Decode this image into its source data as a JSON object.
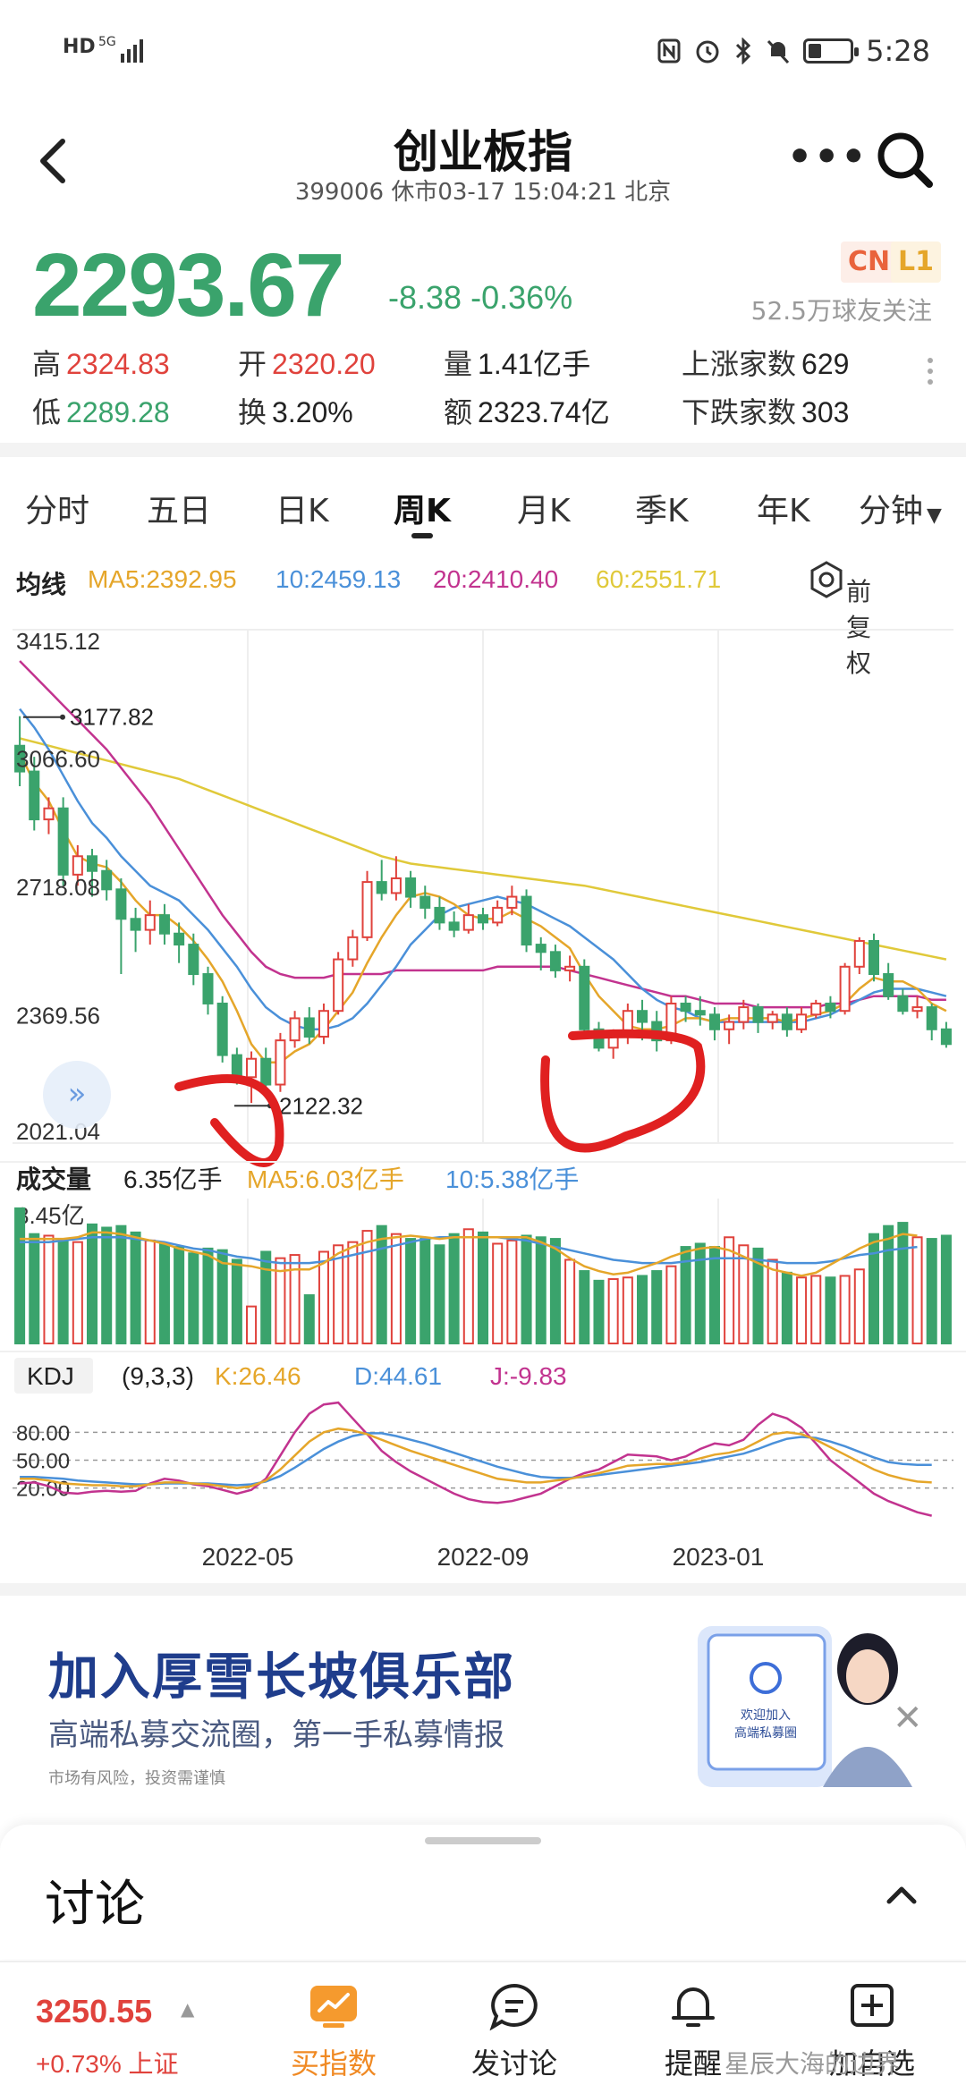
{
  "status": {
    "network_left": "HD",
    "network_type": "5G",
    "time": "5:28"
  },
  "header": {
    "title": "创业板指",
    "subtitle": "399006 休市03-17 15:04:21 北京"
  },
  "quote": {
    "price": "2293.67",
    "change": "-8.38",
    "change_pct": "-0.36%",
    "badge_cn": "CN",
    "badge_l1": "L1",
    "followers": "52.5万球友关注",
    "stats": {
      "high_label": "高",
      "high": "2324.83",
      "open_label": "开",
      "open": "2320.20",
      "volume_label": "量",
      "volume": "1.41亿手",
      "up_label": "上涨家数",
      "up": "629",
      "low_label": "低",
      "low": "2289.28",
      "turnover_label": "换",
      "turnover": "3.20%",
      "amount_label": "额",
      "amount": "2323.74亿",
      "down_label": "下跌家数",
      "down": "303"
    }
  },
  "tabs": [
    "分时",
    "五日",
    "日K",
    "周K",
    "月K",
    "季K",
    "年K",
    "分钟"
  ],
  "active_tab": "周K",
  "ma": {
    "label": "均线",
    "ma5": "MA5:2392.95",
    "ma10": "10:2459.13",
    "ma20": "20:2410.40",
    "ma60": "60:2551.71",
    "restore_label": "前复权"
  },
  "colors": {
    "up": "#e0423c",
    "down": "#3aa36c",
    "ma5": "#e5a62a",
    "ma10": "#4a90d9",
    "ma20": "#c2338f",
    "ma60": "#e0c93a",
    "annotation": "#e02020"
  },
  "chart_data": {
    "type": "candlestick",
    "y_ticks": [
      "3415.12",
      "3066.60",
      "2718.08",
      "2369.56",
      "2021.04"
    ],
    "ylim": [
      2021.04,
      3415.12
    ],
    "high_marker": "3177.82",
    "low_marker": "2122.32",
    "x_ticks": [
      "2022-05",
      "2022-09",
      "2023-01"
    ],
    "candles": [
      [
        3100,
        3030,
        3180,
        2990
      ],
      [
        3030,
        2900,
        3070,
        2870
      ],
      [
        2900,
        2930,
        2960,
        2860
      ],
      [
        2930,
        2750,
        2960,
        2720
      ],
      [
        2750,
        2800,
        2830,
        2720
      ],
      [
        2800,
        2760,
        2820,
        2690
      ],
      [
        2760,
        2710,
        2790,
        2680
      ],
      [
        2710,
        2630,
        2740,
        2480
      ],
      [
        2630,
        2600,
        2660,
        2540
      ],
      [
        2600,
        2640,
        2680,
        2560
      ],
      [
        2640,
        2590,
        2670,
        2560
      ],
      [
        2590,
        2560,
        2620,
        2510
      ],
      [
        2560,
        2480,
        2590,
        2450
      ],
      [
        2480,
        2400,
        2500,
        2370
      ],
      [
        2400,
        2260,
        2420,
        2240
      ],
      [
        2260,
        2200,
        2280,
        2180
      ],
      [
        2200,
        2250,
        2270,
        2130
      ],
      [
        2250,
        2180,
        2280,
        2150
      ],
      [
        2180,
        2300,
        2320,
        2160
      ],
      [
        2300,
        2360,
        2380,
        2280
      ],
      [
        2360,
        2310,
        2390,
        2290
      ],
      [
        2310,
        2380,
        2400,
        2290
      ],
      [
        2380,
        2520,
        2540,
        2370
      ],
      [
        2520,
        2580,
        2600,
        2500
      ],
      [
        2580,
        2730,
        2760,
        2570
      ],
      [
        2730,
        2700,
        2790,
        2680
      ],
      [
        2700,
        2740,
        2800,
        2680
      ],
      [
        2740,
        2690,
        2760,
        2660
      ],
      [
        2690,
        2660,
        2720,
        2630
      ],
      [
        2660,
        2620,
        2690,
        2600
      ],
      [
        2620,
        2600,
        2650,
        2580
      ],
      [
        2600,
        2640,
        2670,
        2590
      ],
      [
        2640,
        2620,
        2660,
        2600
      ],
      [
        2620,
        2660,
        2680,
        2610
      ],
      [
        2660,
        2690,
        2720,
        2640
      ],
      [
        2690,
        2560,
        2710,
        2540
      ],
      [
        2560,
        2540,
        2580,
        2490
      ],
      [
        2540,
        2490,
        2560,
        2470
      ],
      [
        2490,
        2500,
        2530,
        2460
      ],
      [
        2500,
        2330,
        2520,
        2320
      ],
      [
        2330,
        2280,
        2350,
        2270
      ],
      [
        2280,
        2310,
        2330,
        2250
      ],
      [
        2310,
        2380,
        2400,
        2290
      ],
      [
        2380,
        2350,
        2410,
        2300
      ],
      [
        2350,
        2300,
        2380,
        2270
      ],
      [
        2300,
        2400,
        2420,
        2290
      ],
      [
        2400,
        2380,
        2420,
        2350
      ],
      [
        2380,
        2370,
        2420,
        2340
      ],
      [
        2370,
        2330,
        2390,
        2300
      ],
      [
        2330,
        2350,
        2370,
        2290
      ],
      [
        2350,
        2390,
        2410,
        2330
      ],
      [
        2390,
        2350,
        2400,
        2320
      ],
      [
        2350,
        2370,
        2380,
        2330
      ],
      [
        2370,
        2330,
        2390,
        2310
      ],
      [
        2330,
        2370,
        2390,
        2320
      ],
      [
        2370,
        2400,
        2410,
        2360
      ],
      [
        2400,
        2380,
        2420,
        2360
      ],
      [
        2380,
        2500,
        2510,
        2370
      ],
      [
        2500,
        2570,
        2580,
        2480
      ],
      [
        2570,
        2480,
        2590,
        2460
      ],
      [
        2480,
        2420,
        2510,
        2410
      ],
      [
        2420,
        2380,
        2440,
        2370
      ],
      [
        2380,
        2390,
        2420,
        2360
      ],
      [
        2390,
        2330,
        2400,
        2300
      ],
      [
        2330,
        2290,
        2350,
        2280
      ]
    ],
    "ma5": [
      3080,
      3000,
      2950,
      2870,
      2800,
      2780,
      2770,
      2730,
      2680,
      2640,
      2640,
      2610,
      2570,
      2520,
      2460,
      2380,
      2290,
      2240,
      2240,
      2270,
      2290,
      2330,
      2380,
      2430,
      2510,
      2580,
      2640,
      2690,
      2700,
      2690,
      2670,
      2640,
      2630,
      2630,
      2650,
      2630,
      2610,
      2580,
      2550,
      2480,
      2420,
      2380,
      2340,
      2330,
      2330,
      2340,
      2360,
      2360,
      2350,
      2360,
      2360,
      2360,
      2360,
      2350,
      2360,
      2370,
      2380,
      2400,
      2440,
      2470,
      2460,
      2460,
      2440,
      2400,
      2380
    ],
    "ma10": [
      3200,
      3150,
      3090,
      3020,
      2950,
      2890,
      2850,
      2800,
      2760,
      2720,
      2700,
      2680,
      2640,
      2600,
      2550,
      2500,
      2440,
      2390,
      2360,
      2340,
      2330,
      2330,
      2340,
      2360,
      2400,
      2450,
      2500,
      2560,
      2600,
      2640,
      2660,
      2670,
      2680,
      2690,
      2680,
      2670,
      2650,
      2630,
      2610,
      2580,
      2550,
      2520,
      2480,
      2440,
      2410,
      2390,
      2380,
      2360,
      2350,
      2350,
      2350,
      2350,
      2350,
      2350,
      2350,
      2360,
      2370,
      2390,
      2410,
      2430,
      2440,
      2440,
      2440,
      2430,
      2420
    ],
    "ma20": [
      3330,
      3290,
      3250,
      3210,
      3170,
      3130,
      3090,
      3040,
      2990,
      2940,
      2880,
      2820,
      2760,
      2700,
      2640,
      2590,
      2540,
      2500,
      2480,
      2470,
      2470,
      2470,
      2480,
      2480,
      2480,
      2480,
      2490,
      2490,
      2490,
      2490,
      2490,
      2490,
      2490,
      2500,
      2500,
      2500,
      2500,
      2500,
      2490,
      2480,
      2470,
      2460,
      2450,
      2440,
      2430,
      2420,
      2420,
      2410,
      2400,
      2400,
      2400,
      2390,
      2390,
      2390,
      2390,
      2390,
      2400,
      2400,
      2410,
      2420,
      2420,
      2420,
      2420,
      2410,
      2410
    ],
    "ma60": [
      3120,
      3110,
      3100,
      3090,
      3080,
      3070,
      3060,
      3050,
      3040,
      3030,
      3020,
      3010,
      2995,
      2980,
      2965,
      2950,
      2935,
      2920,
      2905,
      2890,
      2875,
      2860,
      2845,
      2830,
      2815,
      2800,
      2790,
      2780,
      2775,
      2770,
      2765,
      2760,
      2755,
      2750,
      2745,
      2740,
      2735,
      2730,
      2725,
      2720,
      2712,
      2704,
      2696,
      2688,
      2680,
      2672,
      2664,
      2656,
      2648,
      2640,
      2632,
      2624,
      2616,
      2608,
      2600,
      2592,
      2584,
      2576,
      2568,
      2560,
      2552,
      2544,
      2536,
      2528,
      2520
    ],
    "volume": {
      "label": "成交量",
      "current": "6.35亿手",
      "ma5": "MA5:6.03亿手",
      "ma10": "10:5.38亿手",
      "top_tick": "8.45亿",
      "max": 8.45,
      "values": [
        8.4,
        6.8,
        6.7,
        6.5,
        6.3,
        7.4,
        7.2,
        7.3,
        6.9,
        6.4,
        6.2,
        6.0,
        5.6,
        5.9,
        5.8,
        5.2,
        2.3,
        5.7,
        5.3,
        5.5,
        3.0,
        5.7,
        6.1,
        6.3,
        7.0,
        7.3,
        6.8,
        6.5,
        6.5,
        6.1,
        6.8,
        7.1,
        6.9,
        6.2,
        6.4,
        6.7,
        6.6,
        6.5,
        5.2,
        4.5,
        3.9,
        4.0,
        4.1,
        4.2,
        4.5,
        4.8,
        6.0,
        6.2,
        6.0,
        6.6,
        6.1,
        5.9,
        5.2,
        4.4,
        4.1,
        4.2,
        4.1,
        4.2,
        4.6,
        6.8,
        7.3,
        7.5,
        6.6,
        6.5,
        6.7
      ],
      "ma5_line": [
        6.5,
        6.5,
        6.5,
        6.5,
        6.6,
        6.9,
        6.9,
        6.8,
        6.6,
        6.4,
        6.2,
        5.9,
        5.7,
        5.5,
        5.0,
        4.9,
        4.8,
        4.6,
        4.5,
        4.6,
        4.6,
        5.0,
        5.6,
        6.0,
        6.3,
        6.5,
        6.6,
        6.7,
        6.6,
        6.5,
        6.6,
        6.6,
        6.6,
        6.6,
        6.6,
        6.6,
        6.3,
        5.9,
        5.3,
        4.8,
        4.5,
        4.3,
        4.4,
        4.7,
        5.0,
        5.4,
        5.7,
        5.9,
        6.0,
        5.8,
        5.4,
        5.0,
        4.6,
        4.4,
        4.2,
        4.4,
        4.9,
        5.4,
        5.9,
        6.3,
        6.5,
        6.8,
        6.7
      ],
      "ma10_line": [
        6.3,
        6.3,
        6.3,
        6.4,
        6.5,
        6.6,
        6.6,
        6.6,
        6.5,
        6.4,
        6.3,
        6.1,
        5.9,
        5.8,
        5.6,
        5.4,
        5.3,
        5.1,
        5.0,
        5.0,
        5.0,
        5.1,
        5.3,
        5.5,
        5.7,
        5.9,
        6.1,
        6.3,
        6.5,
        6.6,
        6.6,
        6.6,
        6.6,
        6.6,
        6.5,
        6.4,
        6.2,
        6.0,
        5.8,
        5.6,
        5.4,
        5.2,
        5.1,
        5.0,
        5.0,
        5.0,
        5.1,
        5.2,
        5.3,
        5.3,
        5.3,
        5.2,
        5.1,
        5.0,
        5.0,
        5.0,
        5.1,
        5.3,
        5.5,
        5.6,
        5.8,
        5.9,
        6.0
      ]
    },
    "kdj": {
      "label": "KDJ",
      "params": "(9,3,3)",
      "k": "K:26.46",
      "d": "D:44.61",
      "j": "J:-9.83",
      "ticks": [
        "80.00",
        "50.00",
        "20.00"
      ],
      "k_line": [
        30,
        30,
        28,
        25,
        24,
        23,
        23,
        22,
        22,
        24,
        26,
        26,
        25,
        24,
        22,
        20,
        22,
        28,
        40,
        55,
        70,
        80,
        84,
        82,
        78,
        72,
        66,
        60,
        55,
        50,
        45,
        40,
        35,
        30,
        28,
        26,
        26,
        28,
        30,
        33,
        36,
        40,
        44,
        45,
        46,
        46,
        48,
        52,
        56,
        58,
        62,
        70,
        78,
        80,
        78,
        72,
        64,
        56,
        48,
        40,
        34,
        30,
        27,
        26
      ],
      "d_line": [
        32,
        32,
        31,
        30,
        28,
        27,
        26,
        25,
        24,
        24,
        25,
        25,
        25,
        25,
        24,
        23,
        24,
        27,
        33,
        42,
        52,
        62,
        70,
        76,
        79,
        79,
        76,
        72,
        68,
        63,
        58,
        53,
        48,
        43,
        39,
        35,
        32,
        31,
        31,
        32,
        34,
        36,
        38,
        40,
        42,
        44,
        46,
        48,
        51,
        54,
        57,
        62,
        68,
        73,
        75,
        74,
        70,
        65,
        59,
        53,
        48,
        46,
        45,
        45
      ],
      "j_line": [
        25,
        26,
        22,
        15,
        14,
        16,
        17,
        16,
        17,
        25,
        30,
        28,
        24,
        22,
        18,
        14,
        18,
        30,
        55,
        80,
        100,
        110,
        112,
        95,
        78,
        60,
        48,
        38,
        30,
        22,
        14,
        8,
        5,
        4,
        6,
        10,
        14,
        22,
        30,
        36,
        40,
        48,
        56,
        55,
        54,
        50,
        54,
        62,
        68,
        66,
        72,
        88,
        100,
        95,
        85,
        68,
        50,
        38,
        26,
        14,
        6,
        0,
        -6,
        -9.83
      ]
    }
  },
  "ad": {
    "title": "加入厚雪长坡俱乐部",
    "subtitle": "高端私募交流圈，第一手私募情报",
    "risk": "市场有风险，投资需谨慎",
    "card_text1": "欢迎加入",
    "card_text2": "高端私募圈"
  },
  "discussion": {
    "title": "讨论"
  },
  "bottom_bar": {
    "index_price": "3250.55",
    "index_change": "+0.73% 上证",
    "buy_label": "买指数",
    "post_label": "发讨论",
    "remind_label": "提醒",
    "watchlist_label": "加自选",
    "watermark": "星辰大海的边界"
  }
}
